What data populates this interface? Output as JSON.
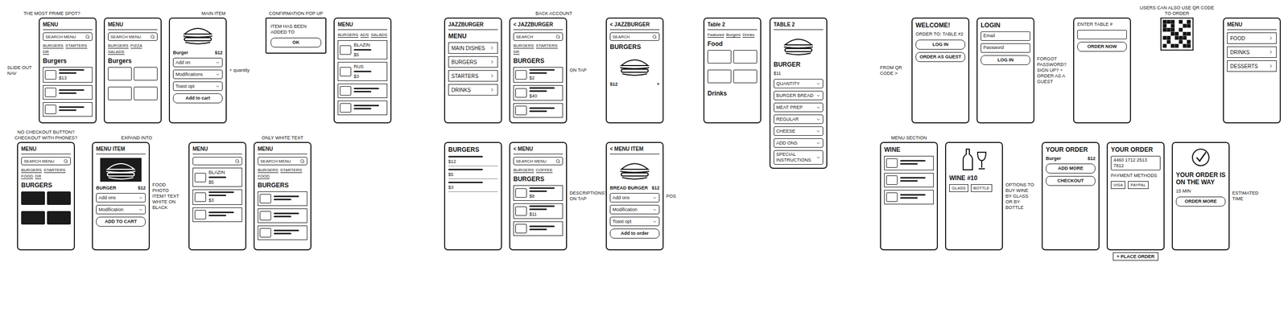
{
  "groups": [
    {
      "name": "first-concepts",
      "rows": [
        [
          {
            "kind": "phone",
            "top": "THE MOST PRIME SPOT?",
            "left": "SLIDE OUT NAV",
            "blocks": [
              {
                "kind": "header",
                "text": "MENU"
              },
              {
                "kind": "search",
                "text": "SEARCH MENU"
              },
              {
                "kind": "tabs",
                "items": [
                  "BURGERS",
                  "STARTERS",
                  "DR"
                ]
              },
              {
                "kind": "title",
                "text": "Burgers"
              },
              {
                "kind": "row",
                "name": "",
                "price": "$13"
              },
              {
                "kind": "row",
                "name": "",
                "price": ""
              },
              {
                "kind": "row",
                "name": "",
                "price": ""
              }
            ]
          },
          {
            "kind": "phone",
            "blocks": [
              {
                "kind": "header",
                "text": "MENU"
              },
              {
                "kind": "search",
                "text": "SEARCH MENU"
              },
              {
                "kind": "tabs",
                "items": [
                  "BURGERS",
                  "PIZZA",
                  "SALADS"
                ]
              },
              {
                "kind": "title",
                "text": "Burgers"
              },
              {
                "kind": "grid",
                "dark": false,
                "cells": [
                  "",
                  "",
                  "",
                  ""
                ]
              }
            ]
          },
          {
            "kind": "phone",
            "top": "MAIN ITEM",
            "right": "+ quantity",
            "blocks": [
              {
                "kind": "burger-image",
                "dark": false
              },
              {
                "kind": "price-line",
                "name": "Burger",
                "price": "$12"
              },
              {
                "kind": "field",
                "text": "Add on"
              },
              {
                "kind": "field",
                "text": "Modifications"
              },
              {
                "kind": "field",
                "text": "Toast opt"
              },
              {
                "kind": "button",
                "text": "Add to cart"
              }
            ]
          },
          {
            "kind": "popup",
            "top": "CONFIRMATION POP UP",
            "blocks": [
              {
                "kind": "text",
                "text": "ITEM HAS BEEN ADDED TO"
              },
              {
                "kind": "button",
                "text": "OK"
              }
            ]
          },
          {
            "kind": "phone",
            "blocks": [
              {
                "kind": "header",
                "text": "MENU"
              },
              {
                "kind": "tabs",
                "items": [
                  "BURGERS",
                  "ADS",
                  "SALADS"
                ]
              },
              {
                "kind": "row",
                "name": "BLAZIN",
                "price": "$5"
              },
              {
                "kind": "row",
                "name": "RUS",
                "price": "$3"
              },
              {
                "kind": "row",
                "name": "",
                "price": ""
              },
              {
                "kind": "row",
                "name": "",
                "price": ""
              }
            ]
          }
        ],
        [
          {
            "kind": "phone",
            "top": "NO CHECKOUT BUTTON? CHECKOUT WITH PHONES?",
            "blocks": [
              {
                "kind": "header",
                "text": "MENU"
              },
              {
                "kind": "search",
                "text": "SEARCH MENU"
              },
              {
                "kind": "tabs",
                "items": [
                  "BURGERS",
                  "STARTERS",
                  "FOOD",
                  "DR"
                ]
              },
              {
                "kind": "title",
                "text": "BURGERS"
              },
              {
                "kind": "grid",
                "dark": true,
                "cells": [
                  "",
                  "",
                  "",
                  ""
                ]
              }
            ]
          },
          {
            "kind": "phone",
            "top": "EXPAND INTO",
            "right": "FOOD PHOTO ITEM? TEXT WHITE ON BLACK",
            "blocks": [
              {
                "kind": "header",
                "text": "MENU ITEM"
              },
              {
                "kind": "burger-image",
                "dark": true
              },
              {
                "kind": "price-line",
                "name": "BURGER",
                "price": "$12"
              },
              {
                "kind": "field",
                "text": "Add ons"
              },
              {
                "kind": "field",
                "text": "Modification"
              },
              {
                "kind": "button",
                "text": "ADD TO CART"
              }
            ]
          },
          {
            "kind": "phone",
            "blocks": [
              {
                "kind": "header",
                "text": "MENU"
              },
              {
                "kind": "search",
                "text": ""
              },
              {
                "kind": "row",
                "name": "BLAZIN",
                "price": "$5"
              },
              {
                "kind": "row",
                "name": "",
                "price": "$3"
              },
              {
                "kind": "row",
                "name": "",
                "price": ""
              }
            ]
          },
          {
            "kind": "phone",
            "top": "ONLY WHITE TEXT",
            "blocks": [
              {
                "kind": "header",
                "text": "MENU"
              },
              {
                "kind": "search",
                "text": "SEARCH MENU"
              },
              {
                "kind": "tabs",
                "items": [
                  "BURGERS",
                  "STARTERS",
                  "FOOD"
                ]
              },
              {
                "kind": "title",
                "text": "BURGERS"
              },
              {
                "kind": "row",
                "name": "",
                "price": ""
              },
              {
                "kind": "row",
                "name": "",
                "price": ""
              },
              {
                "kind": "row",
                "name": "",
                "price": ""
              }
            ]
          }
        ]
      ],
      "side": []
    },
    {
      "name": "jazzburger-concepts",
      "rows": [
        [
          {
            "kind": "phone",
            "blocks": [
              {
                "kind": "header",
                "text": "JAZZBURGER"
              },
              {
                "kind": "title",
                "text": "MENU"
              },
              {
                "kind": "nav",
                "text": "MAIN DISHES"
              },
              {
                "kind": "nav",
                "text": "BURGERS"
              },
              {
                "kind": "nav",
                "text": "STARTERS"
              },
              {
                "kind": "nav",
                "text": "DRINKS"
              }
            ]
          },
          {
            "kind": "phone",
            "top": "BACK  ACCOUNT",
            "right": "ON TAP",
            "blocks": [
              {
                "kind": "header",
                "text": "< JAZZBURGER"
              },
              {
                "kind": "search",
                "text": "SEARCH"
              },
              {
                "kind": "tabs",
                "items": [
                  "BURGERS",
                  "STARTERS",
                  "DR"
                ]
              },
              {
                "kind": "title",
                "text": "BURGERS"
              },
              {
                "kind": "row",
                "name": "",
                "price": "$2"
              },
              {
                "kind": "row",
                "name": "",
                "price": "$40"
              },
              {
                "kind": "row",
                "name": "",
                "price": ""
              }
            ]
          },
          {
            "kind": "phone",
            "blocks": [
              {
                "kind": "header",
                "text": "< JAZZBURGER"
              },
              {
                "kind": "search",
                "text": "SEARCH"
              },
              {
                "kind": "title",
                "text": "BURGERS"
              },
              {
                "kind": "burger-image",
                "dark": false
              },
              {
                "kind": "price-line",
                "name": "$12",
                "price": "+"
              }
            ]
          }
        ],
        [
          {
            "kind": "phone",
            "blocks": [
              {
                "kind": "title",
                "text": "BURGERS"
              },
              {
                "kind": "line",
                "price": "$12"
              },
              {
                "kind": "line",
                "price": "$5"
              },
              {
                "kind": "line",
                "price": "$3"
              }
            ]
          },
          {
            "kind": "phone",
            "right": "DESCRIPTIONS? ON TAP",
            "blocks": [
              {
                "kind": "header",
                "text": "< MENU"
              },
              {
                "kind": "search",
                "text": "SEARCH MENU"
              },
              {
                "kind": "tabs",
                "items": [
                  "BURGERS",
                  "COFFEE"
                ]
              },
              {
                "kind": "title",
                "text": "BURGERS"
              },
              {
                "kind": "row",
                "name": "",
                "price": "$8"
              },
              {
                "kind": "row",
                "name": "",
                "price": "$11"
              },
              {
                "kind": "row",
                "name": "",
                "price": ""
              }
            ]
          },
          {
            "kind": "phone",
            "right": "POS",
            "blocks": [
              {
                "kind": "header",
                "text": "< MENU ITEM"
              },
              {
                "kind": "burger-image",
                "dark": false
              },
              {
                "kind": "price-line",
                "name": "BREAD BURGER",
                "price": "$12"
              },
              {
                "kind": "field",
                "text": "Add ons"
              },
              {
                "kind": "field",
                "text": "Modification"
              },
              {
                "kind": "field",
                "text": "Toast opt"
              },
              {
                "kind": "button",
                "text": "Add to order"
              }
            ]
          }
        ]
      ],
      "side": [
        {
          "kind": "phone",
          "blocks": [
            {
              "kind": "header",
              "text": "Table 2"
            },
            {
              "kind": "tabs",
              "items": [
                "Featured",
                "Burgers",
                "Drinks"
              ]
            },
            {
              "kind": "title",
              "text": "Food"
            },
            {
              "kind": "grid",
              "dark": false,
              "cells": [
                "",
                "",
                "",
                ""
              ]
            },
            {
              "kind": "title",
              "text": "Drinks"
            }
          ]
        },
        {
          "kind": "phone",
          "blocks": [
            {
              "kind": "header",
              "text": "TABLE 2"
            },
            {
              "kind": "burger-image",
              "dark": false
            },
            {
              "kind": "title",
              "text": "BURGER"
            },
            {
              "kind": "text",
              "text": "$11"
            },
            {
              "kind": "field",
              "text": "QUANTITY"
            },
            {
              "kind": "field",
              "text": "BURGER BREAD"
            },
            {
              "kind": "field",
              "text": "MEAT PREP"
            },
            {
              "kind": "field",
              "text": "REGULAR"
            },
            {
              "kind": "field",
              "text": "CHEESE"
            },
            {
              "kind": "field",
              "text": "ADD ONS"
            },
            {
              "kind": "field",
              "text": "SPECIAL INSTRUCTIONS"
            }
          ]
        }
      ]
    },
    {
      "name": "qr-ordering-flow",
      "rows": [
        [
          {
            "kind": "phone",
            "left": "FROM QR CODE >",
            "blocks": [
              {
                "kind": "title",
                "text": "WELCOME!"
              },
              {
                "kind": "text",
                "text": "ORDER TO: TABLE #2"
              },
              {
                "kind": "button",
                "text": "LOG IN"
              },
              {
                "kind": "button",
                "text": "ORDER AS GUEST"
              }
            ]
          },
          {
            "kind": "phone",
            "right": "FORGOT PASSWORD? SIGN UP? + ORDER AS A GUEST",
            "blocks": [
              {
                "kind": "title",
                "text": "LOGIN"
              },
              {
                "kind": "input",
                "text": "Email"
              },
              {
                "kind": "input",
                "text": "Password"
              },
              {
                "kind": "button",
                "text": "LOG IN"
              }
            ]
          },
          {
            "kind": "phone",
            "blocks": [
              {
                "kind": "text",
                "text": "ENTER TABLE #"
              },
              {
                "kind": "input",
                "text": ""
              },
              {
                "kind": "button",
                "text": "ORDER NOW"
              }
            ]
          },
          {
            "kind": "qr",
            "top": "USERS CAN ALSO USE QR CODE TO ORDER",
            "blocks": []
          },
          {
            "kind": "phone",
            "blocks": [
              {
                "kind": "header",
                "text": "MENU"
              },
              {
                "kind": "nav",
                "text": "FOOD"
              },
              {
                "kind": "nav",
                "text": "DRINKS"
              },
              {
                "kind": "nav",
                "text": "DESSERTS"
              }
            ]
          }
        ],
        [
          {
            "kind": "phone",
            "top": "MENU SECTION",
            "blocks": [
              {
                "kind": "title",
                "text": "WINE"
              },
              {
                "kind": "row",
                "name": "",
                "price": ""
              },
              {
                "kind": "row",
                "name": "",
                "price": ""
              },
              {
                "kind": "row",
                "name": "",
                "price": ""
              }
            ]
          },
          {
            "kind": "phone",
            "right": "OPTIONS TO BUY WINE BY GLASS OR BY BOTTLE",
            "blocks": [
              {
                "kind": "wine-image"
              },
              {
                "kind": "title",
                "text": "WINE #10"
              },
              {
                "kind": "choices",
                "items": [
                  "GLASS",
                  "BOTTLE"
                ]
              }
            ]
          },
          {
            "kind": "phone",
            "blocks": [
              {
                "kind": "title",
                "text": "YOUR ORDER"
              },
              {
                "kind": "price-line",
                "name": "Burger",
                "price": "$12"
              },
              {
                "kind": "button",
                "text": "ADD MORE"
              },
              {
                "kind": "button",
                "text": "CHECKOUT"
              }
            ]
          },
          {
            "kind": "phone",
            "bottom": "+ PLACE ORDER",
            "blocks": [
              {
                "kind": "title",
                "text": "YOUR ORDER"
              },
              {
                "kind": "input",
                "text": "4460 1712 2513 7812"
              },
              {
                "kind": "text",
                "text": "PAYMENT METHODS"
              },
              {
                "kind": "choices",
                "items": [
                  "VISA",
                  "PAYPAL"
                ]
              }
            ]
          },
          {
            "kind": "phone",
            "right": "ESTIMATED TIME",
            "blocks": [
              {
                "kind": "check"
              },
              {
                "kind": "title",
                "text": "YOUR ORDER IS ON THE WAY"
              },
              {
                "kind": "text",
                "text": "15 MIN"
              },
              {
                "kind": "button",
                "text": "ORDER MORE"
              }
            ]
          }
        ]
      ],
      "side": []
    }
  ]
}
